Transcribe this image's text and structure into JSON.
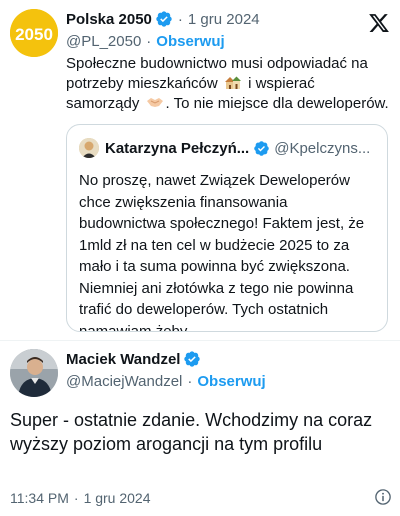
{
  "tweet": {
    "author_name": "Polska 2050",
    "date": "1 gru 2024",
    "handle": "@PL_2050",
    "follow_label": "Obserwuj",
    "text_part1": "Społeczne budownictwo musi odpowiadać na potrzeby mieszkańców",
    "text_part2": "i wspierać samorządy",
    "text_part3": ". To nie miejsce dla deweloperów.",
    "avatar_text": "2050",
    "icons": {
      "house_emoji": "houses-emoji",
      "handshake_emoji": "handshake-emoji",
      "platform": "x-logo-icon",
      "verified": "verified-badge-icon"
    }
  },
  "quote": {
    "author_name": "Katarzyna Pełczyń...",
    "handle": "@Kpelczyns...",
    "text": "No proszę, nawet Związek Deweloperów chce zwiększenia finansowania budownictwa społecznego! Faktem jest, że 1mld zł na ten cel w budżecie 2025 to za mało i ta suma powinna być zwiększona. Niemniej ani złotówka z tego nie powinna trafić do deweloperów. Tych ostatnich namawiam żeby..."
  },
  "reply": {
    "author_name": "Maciek Wandzel",
    "handle": "@MaciejWandzel",
    "follow_label": "Obserwuj",
    "text": "Super - ostatnie zdanie. Wchodzimy na coraz wyższy poziom arogancji na tym profilu",
    "time": "11:34 PM",
    "date": "1 gru 2024",
    "icons": {
      "info": "info-icon"
    }
  },
  "colors": {
    "accent": "#1d9bf0",
    "muted": "#536471",
    "text": "#0f1419",
    "border": "#cfd9de",
    "brand_yellow": "#f4c20d"
  }
}
